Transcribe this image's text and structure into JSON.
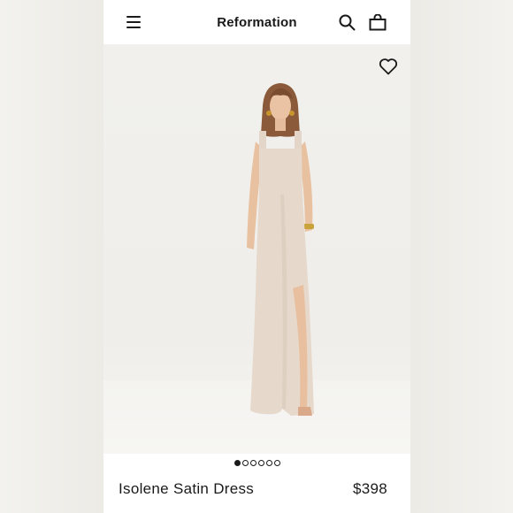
{
  "header": {
    "brand": "Reformation",
    "menu_icon": "hamburger-menu-icon",
    "search_icon": "search-icon",
    "bag_icon": "shopping-bag-icon"
  },
  "hero": {
    "wishlist_icon": "heart-icon",
    "image_subject": "model-wearing-dress",
    "dress_color": "#e6d9cc"
  },
  "carousel": {
    "total": 6,
    "active_index": 0
  },
  "product": {
    "name": "Isolene Satin Dress",
    "price": "$398"
  },
  "colors": {
    "text": "#1a1a1a",
    "background": "#ffffff",
    "hero_background": "#f1f0ec"
  }
}
